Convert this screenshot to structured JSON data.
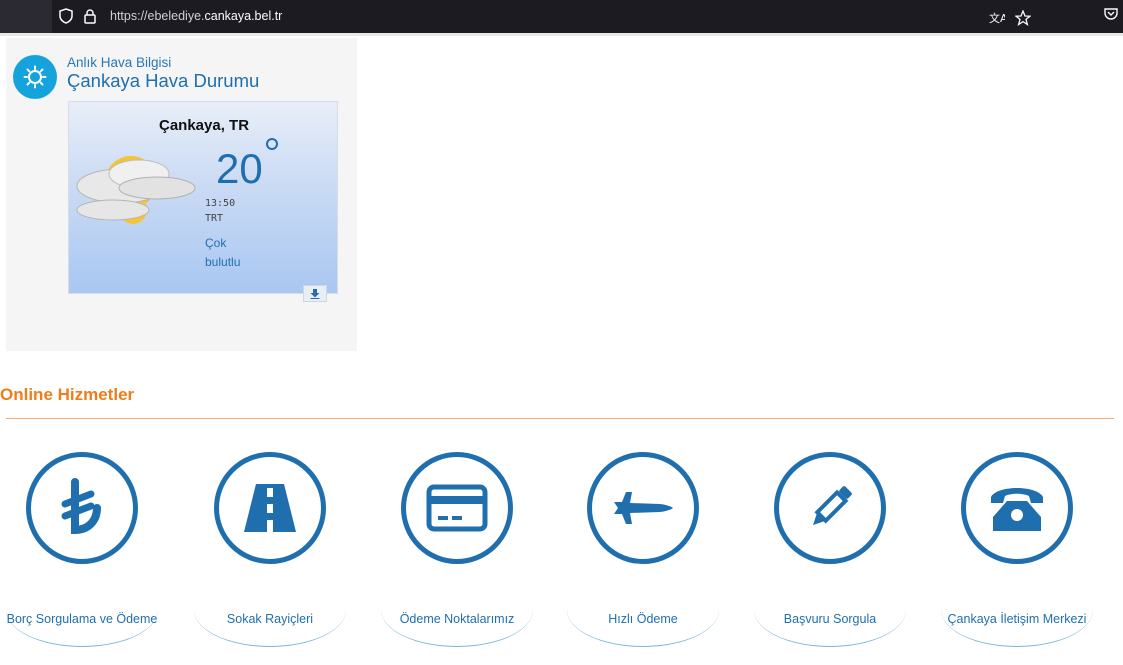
{
  "browser": {
    "url_prefix": "https://ebelediye.",
    "url_host": "cankaya.bel.tr"
  },
  "weather": {
    "subtitle": "Anlık Hava Bilgisi",
    "title": "Çankaya Hava Durumu",
    "city": "Çankaya, TR",
    "temperature": "20",
    "time": "13:50",
    "timezone": "TRT",
    "condition": "Çok bulutlu"
  },
  "services": {
    "title": "Online Hizmetler",
    "items": [
      {
        "label": "Borç Sorgulama ve Ödeme",
        "icon": "lira-icon"
      },
      {
        "label": "Sokak Rayiçleri",
        "icon": "road-icon"
      },
      {
        "label": "Ödeme Noktalarımız",
        "icon": "credit-card-icon"
      },
      {
        "label": "Hızlı Ödeme",
        "icon": "jet-icon"
      },
      {
        "label": "Başvuru Sorgula",
        "icon": "pencil-icon"
      },
      {
        "label": "Çankaya İletişim Merkezi",
        "icon": "telephone-icon"
      }
    ]
  },
  "colors": {
    "brand_blue": "#1f6fae",
    "accent_orange": "#f07c1a",
    "weather_badge": "#14a3dc"
  }
}
